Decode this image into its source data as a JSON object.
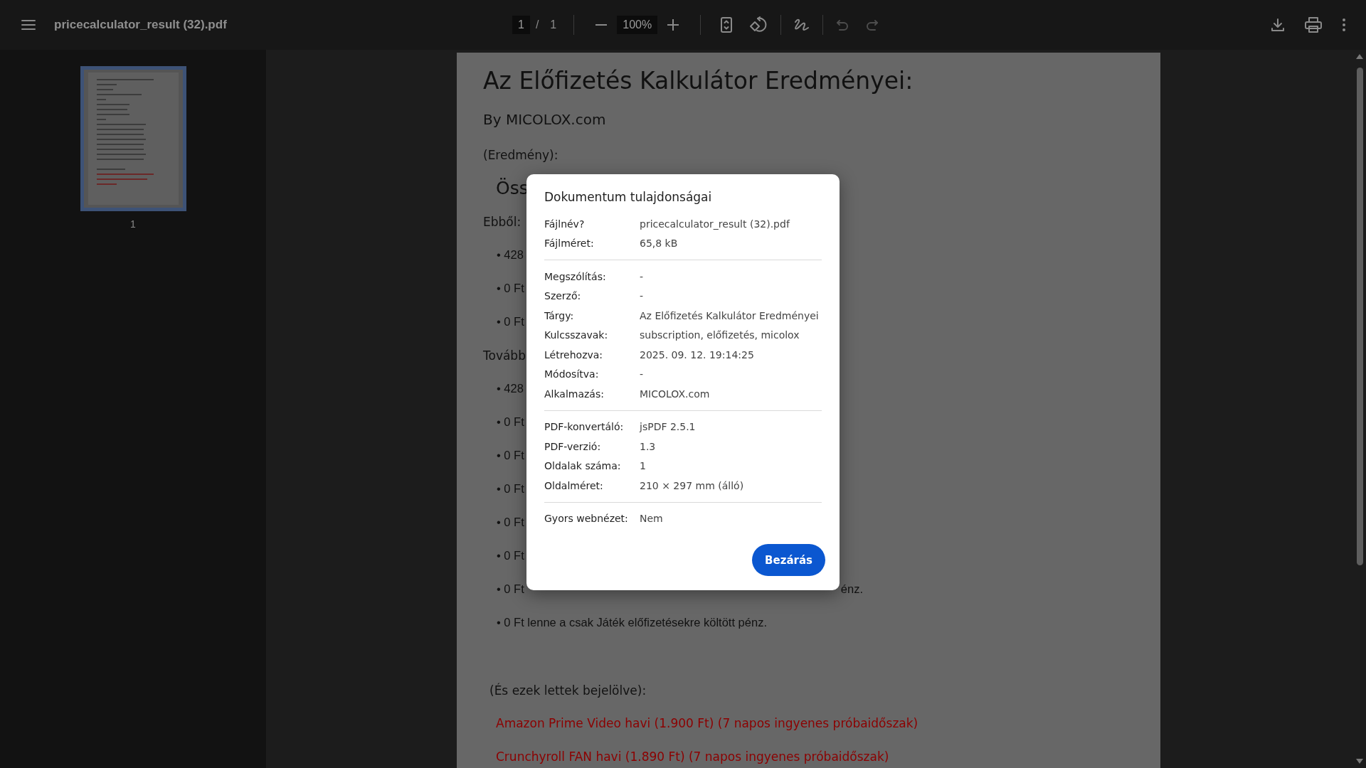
{
  "toolbar": {
    "file_name": "pricecalculator_result (32).pdf",
    "page_input": "1",
    "page_separator": "/",
    "page_total": "1",
    "zoom": "100%",
    "tools": [
      {
        "kind": "fit",
        "disabled": false
      },
      {
        "kind": "rotate",
        "disabled": false
      },
      {
        "kind": "draw",
        "disabled": false
      },
      {
        "kind": "undo",
        "disabled": true
      },
      {
        "kind": "redo",
        "disabled": true
      }
    ],
    "actions": [
      {
        "kind": "download"
      },
      {
        "kind": "print"
      },
      {
        "kind": "more"
      }
    ]
  },
  "sidebar": {
    "thumbnails": [
      {
        "label": "1",
        "selected": true
      }
    ]
  },
  "document": {
    "lines": [
      {
        "kind": "title",
        "text": "Az Előfizetés Kalkulátor Eredményei:"
      },
      {
        "kind": "byline",
        "text": "By MICOLOX.com"
      },
      {
        "kind": "label",
        "text": "(Eredmény):"
      },
      {
        "kind": "heading",
        "text": "Öss"
      },
      {
        "kind": "label",
        "text": "Ebből:"
      },
      {
        "kind": "bullet",
        "text": "• 428"
      },
      {
        "kind": "bullet",
        "text": "• 0 Ft"
      },
      {
        "kind": "bullet",
        "text": "• 0 Ft"
      },
      {
        "kind": "label",
        "text": "Tovább"
      },
      {
        "kind": "bullet",
        "text": "• 428"
      },
      {
        "kind": "bullet",
        "text": "• 0 Ft"
      },
      {
        "kind": "bullet",
        "text": "• 0 Ft"
      },
      {
        "kind": "bullet",
        "text": "• 0 Ft"
      },
      {
        "kind": "bullet",
        "text": "• 0 Ft"
      },
      {
        "kind": "bullet",
        "text": "• 0 Ft"
      },
      {
        "kind": "bullet",
        "text": "• 0 Ft",
        "tail": "énz."
      },
      {
        "kind": "bullet",
        "text": "• 0 Ft lenne a csak Játék előfizetésekre költött pénz."
      },
      {
        "kind": "note",
        "text": "(És ezek lettek bejelölve):"
      },
      {
        "kind": "selection",
        "text": "Amazon Prime Video havi (1.900 Ft) (7 napos ingyenes próbaidőszak)"
      },
      {
        "kind": "selection",
        "text": "Crunchyroll FAN havi (1.890 Ft) (7 napos ingyenes próbaidőszak)"
      }
    ]
  },
  "dialog": {
    "title": "Dokumentum tulajdonságai",
    "sections": [
      [
        {
          "label": "Fájlnév?",
          "value": "pricecalculator_result (32).pdf"
        },
        {
          "label": "Fájlméret:",
          "value": "65,8 kB"
        }
      ],
      [
        {
          "label": "Megszólítás:",
          "value": "-"
        },
        {
          "label": "Szerző:",
          "value": "-"
        },
        {
          "label": "Tárgy:",
          "value": "Az Előfizetés Kalkulátor Eredményei"
        },
        {
          "label": "Kulcsszavak:",
          "value": "subscription, előfizetés, micolox"
        },
        {
          "label": "Létrehozva:",
          "value": "2025. 09. 12. 19:14:25"
        },
        {
          "label": "Módosítva:",
          "value": "-"
        },
        {
          "label": "Alkalmazás:",
          "value": "MICOLOX.com"
        }
      ],
      [
        {
          "label": "PDF-konvertáló:",
          "value": "jsPDF 2.5.1"
        },
        {
          "label": "PDF-verzió:",
          "value": "1.3"
        },
        {
          "label": "Oldalak száma:",
          "value": "1"
        },
        {
          "label": "Oldalméret:",
          "value": "210 × 297 mm (álló)"
        }
      ],
      [
        {
          "label": "Gyors webnézet:",
          "value": "Nem"
        }
      ]
    ],
    "button": "Bezárás"
  }
}
